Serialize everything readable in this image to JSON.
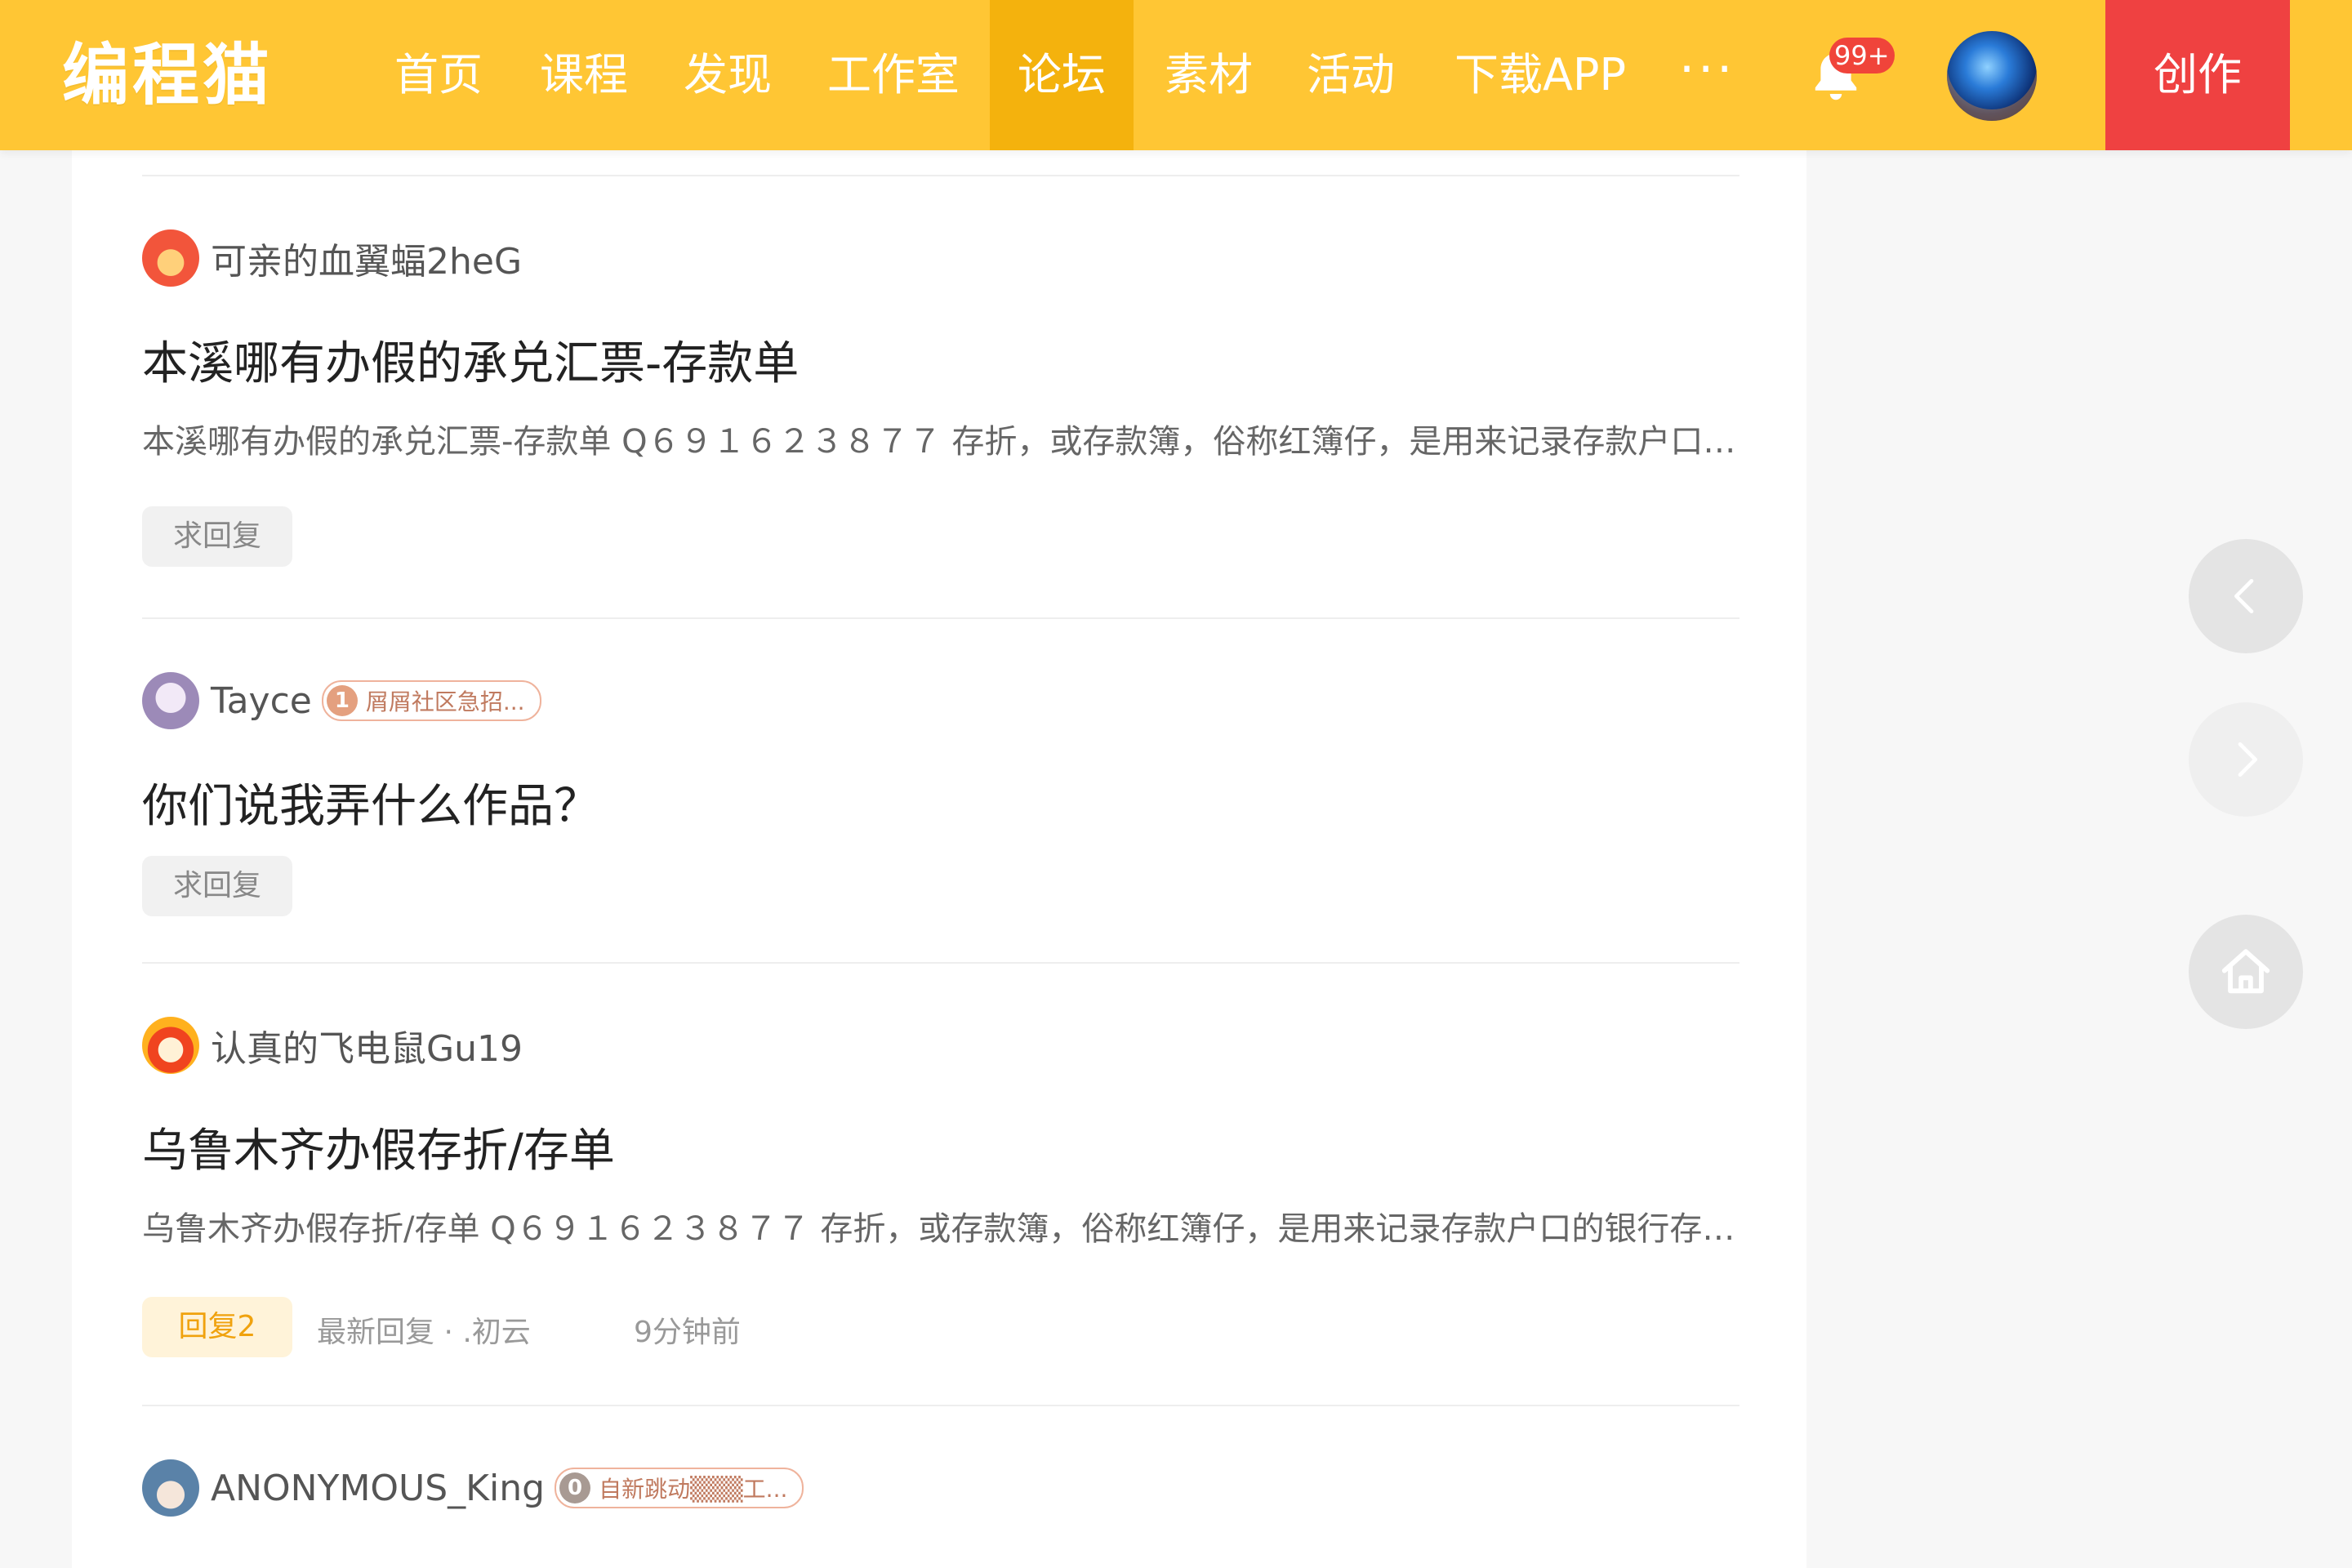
{
  "nav": {
    "logo": "编程猫",
    "items": [
      {
        "label": "首页"
      },
      {
        "label": "课程"
      },
      {
        "label": "发现"
      },
      {
        "label": "工作室"
      },
      {
        "label": "论坛",
        "active": true
      },
      {
        "label": "素材"
      },
      {
        "label": "活动"
      },
      {
        "label": "下载APP"
      }
    ],
    "more": "···",
    "notification_count": "99+",
    "create_label": "创作",
    "icons": {
      "notification": "bell-icon",
      "more": "more-dots-icon",
      "avatar": "user-avatar"
    },
    "colors": {
      "bar": "#ffc634",
      "active": "#f4b20d",
      "create": "#ef4141",
      "badge": "#f0443a"
    }
  },
  "posts": [
    {
      "author": "可亲的血翼蝠2heG",
      "title": "本溪哪有办假的承兑汇票-存款单",
      "excerpt": "本溪哪有办假的承兑汇票-存款单  Q６９１６２３８７７  存折，或存款簿，俗称红簿仔，是用来记录存款户口的银行存款凭证",
      "status_label": "求回复"
    },
    {
      "author": "Tayce",
      "tag_level": "1",
      "tag_text": "屑屑社区急招...",
      "title": "你们说我弄什么作品？",
      "status_label": "求回复"
    },
    {
      "author": "认真的飞电鼠Gu19",
      "title": "乌鲁木齐办假存折/存单",
      "excerpt": "乌鲁木齐办假存折/存单  Q６９１６２３８７７  存折，或存款簿，俗称红簿仔，是用来记录存款户口的银行存款凭证",
      "reply_label": "回复2",
      "latest_reply": "最新回复 · .初云",
      "time": "9分钟前"
    },
    {
      "author": "ANONYMOUS_King",
      "tag_level": "0",
      "tag_text": "自新跳动▒▒▒工..."
    }
  ],
  "floating": {
    "icons": [
      "chevron-left-icon",
      "chevron-right-icon",
      "home-icon"
    ]
  }
}
